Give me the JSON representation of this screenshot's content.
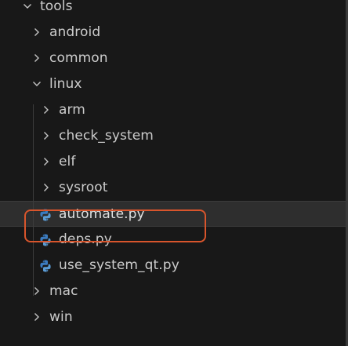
{
  "explorer": {
    "items": [
      {
        "label": "tools",
        "kind": "folder",
        "expanded": true,
        "depth": 0
      },
      {
        "label": "android",
        "kind": "folder",
        "expanded": false,
        "depth": 1
      },
      {
        "label": "common",
        "kind": "folder",
        "expanded": false,
        "depth": 1
      },
      {
        "label": "linux",
        "kind": "folder",
        "expanded": true,
        "depth": 1
      },
      {
        "label": "arm",
        "kind": "folder",
        "expanded": false,
        "depth": 2
      },
      {
        "label": "check_system",
        "kind": "folder",
        "expanded": false,
        "depth": 2
      },
      {
        "label": "elf",
        "kind": "folder",
        "expanded": false,
        "depth": 2
      },
      {
        "label": "sysroot",
        "kind": "folder",
        "expanded": false,
        "depth": 2
      },
      {
        "label": "automate.py",
        "kind": "python-file",
        "selected": true,
        "depth": 2
      },
      {
        "label": "deps.py",
        "kind": "python-file",
        "depth": 2
      },
      {
        "label": "use_system_qt.py",
        "kind": "python-file",
        "depth": 2
      },
      {
        "label": "mac",
        "kind": "folder",
        "expanded": false,
        "depth": 1
      },
      {
        "label": "win",
        "kind": "folder",
        "expanded": false,
        "depth": 1
      }
    ]
  },
  "colors": {
    "background": "#181818",
    "text": "#cccccc",
    "chevron": "#c5c5c5",
    "selected_row": "#2e2e2e",
    "highlight_outline": "#d8552c",
    "python_blue": "#3b7bbf",
    "python_blue_light": "#5a9bd4"
  }
}
